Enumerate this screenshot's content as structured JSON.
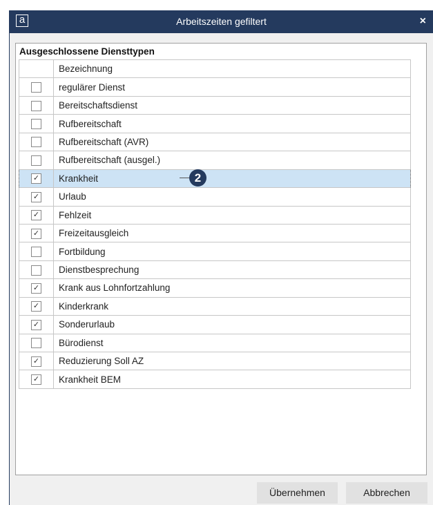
{
  "window": {
    "title": "Arbeitszeiten gefiltert",
    "app_icon": "a",
    "close_glyph": "×"
  },
  "group": {
    "title": "Ausgeschlossene Diensttypen",
    "column_header": "Bezeichnung",
    "rows": [
      {
        "label": "regulärer Dienst",
        "checked": false,
        "check_glyph": ""
      },
      {
        "label": "Bereitschaftsdienst",
        "checked": false,
        "check_glyph": ""
      },
      {
        "label": "Rufbereitschaft",
        "checked": false,
        "check_glyph": ""
      },
      {
        "label": "Rufbereitschaft (AVR)",
        "checked": false,
        "check_glyph": ""
      },
      {
        "label": "Rufbereitschaft (ausgel.)",
        "checked": false,
        "check_glyph": ""
      },
      {
        "label": "Krankheit",
        "checked": true,
        "check_glyph": "✓",
        "selected": true
      },
      {
        "label": "Urlaub",
        "checked": true,
        "check_glyph": "✓"
      },
      {
        "label": "Fehlzeit",
        "checked": true,
        "check_glyph": "✓"
      },
      {
        "label": "Freizeitausgleich",
        "checked": true,
        "check_glyph": "✓"
      },
      {
        "label": "Fortbildung",
        "checked": false,
        "check_glyph": ""
      },
      {
        "label": "Dienstbesprechung",
        "checked": false,
        "check_glyph": ""
      },
      {
        "label": "Krank aus Lohnfortzahlung",
        "checked": true,
        "check_glyph": "✓"
      },
      {
        "label": "Kinderkrank",
        "checked": true,
        "check_glyph": "✓"
      },
      {
        "label": "Sonderurlaub",
        "checked": true,
        "check_glyph": "✓"
      },
      {
        "label": "Bürodienst",
        "checked": false,
        "check_glyph": ""
      },
      {
        "label": "Reduzierung Soll AZ",
        "checked": true,
        "check_glyph": "✓"
      },
      {
        "label": "Krankheit BEM",
        "checked": true,
        "check_glyph": "✓"
      }
    ]
  },
  "callout": {
    "number": "2"
  },
  "buttons": {
    "apply": "Übernehmen",
    "cancel": "Abbrechen"
  },
  "colors": {
    "titlebar": "#243a5e",
    "selection": "#cde3f5",
    "button": "#e1e1e1"
  }
}
